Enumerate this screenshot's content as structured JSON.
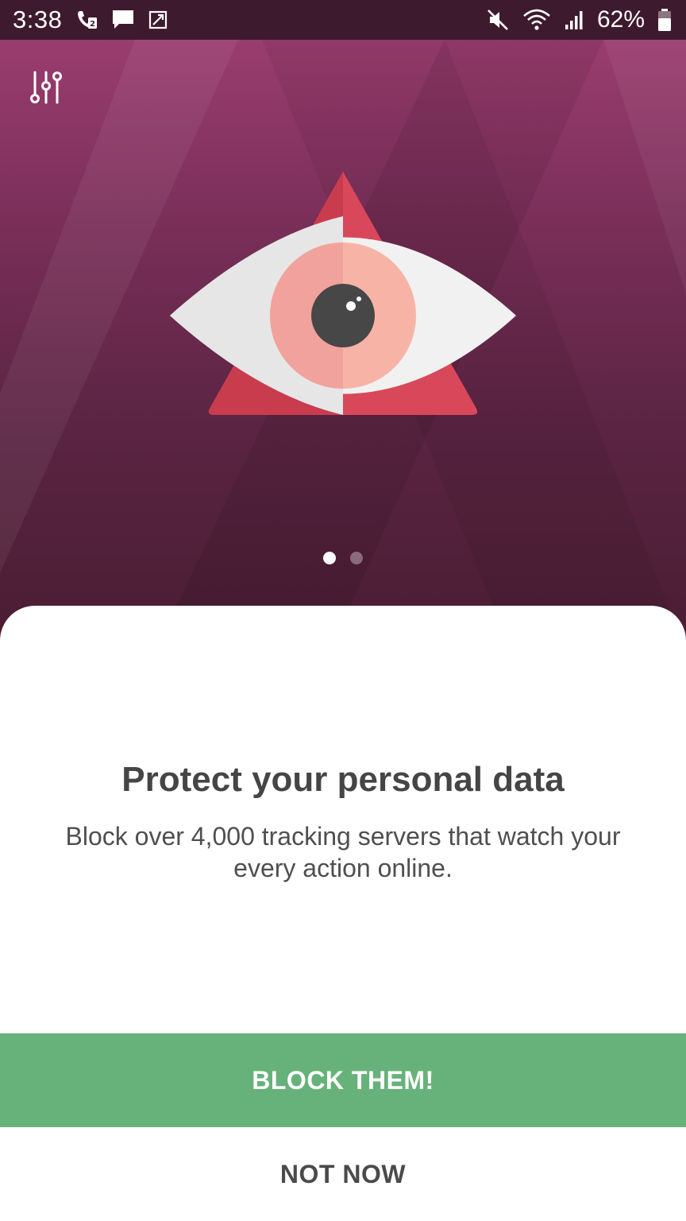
{
  "status_bar": {
    "time": "3:38",
    "battery": "62%",
    "left_icons": [
      "wifi-call-icon",
      "message-icon",
      "screenshot-icon"
    ],
    "right_icons": [
      "mute-icon",
      "wifi-icon",
      "signal-icon",
      "battery-icon"
    ]
  },
  "hero": {
    "settings_icon": "sliders-icon",
    "illustration": "eye-triangle-icon",
    "pager": {
      "pages": 2,
      "active": 0
    },
    "colors": {
      "top": "#9a3d6f",
      "bottom": "#4a1d33",
      "triangle": "#d9485a",
      "iris": "#f6a79e",
      "pupil": "#474747"
    }
  },
  "content": {
    "headline": "Protect your personal data",
    "description": "Block over 4,000 tracking servers that watch your every action online."
  },
  "actions": {
    "primary_label": "BLOCK THEM!",
    "secondary_label": "NOT NOW",
    "primary_color": "#67b27a"
  }
}
